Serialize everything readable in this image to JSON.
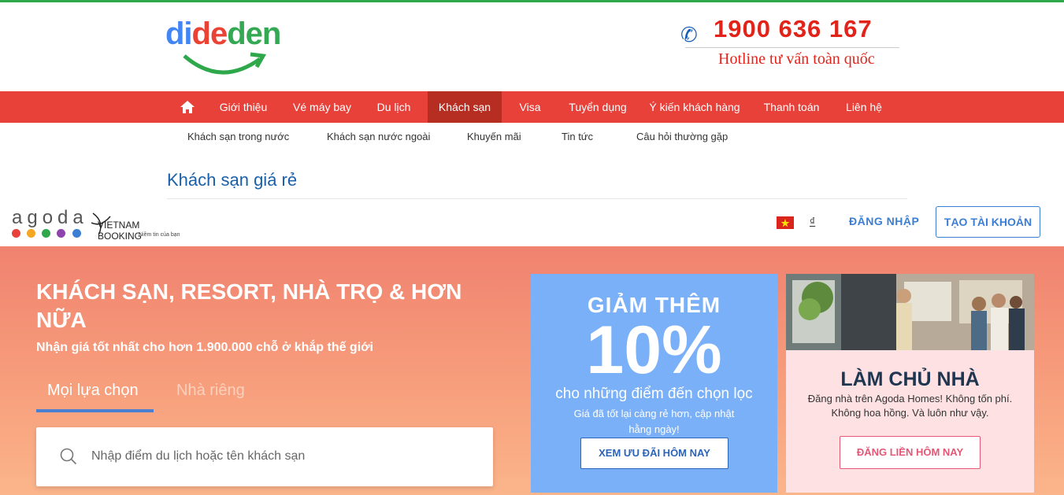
{
  "header": {
    "logo_parts": [
      "di",
      "de",
      "den"
    ],
    "hotline_number": "1900 636 167",
    "hotline_label": "Hotline tư vấn toàn quốc"
  },
  "nav": {
    "items": [
      "Giới thiệu",
      "Vé máy bay",
      "Du lịch",
      "Khách sạn",
      "Visa",
      "Tuyển dụng",
      "Ý kiến khách hàng",
      "Thanh toán",
      "Liên hệ"
    ],
    "active": "Khách sạn"
  },
  "subnav": {
    "items": [
      "Khách sạn trong nước",
      "Khách sạn nước ngoài",
      "Khuyến mãi",
      "Tin tức",
      "Câu hỏi thường gặp"
    ]
  },
  "page_title": "Khách sạn giá rẻ",
  "agoda_bar": {
    "brand": "agoda",
    "partner_title": "VIETNAM BOOKING",
    "partner_tagline": "Niềm tin của bạn",
    "currency": "₫",
    "login": "ĐĂNG NHẬP",
    "signup": "TẠO TÀI KHOẢN",
    "brand_dot_colors": [
      "#e8413a",
      "#f5a623",
      "#2ea84a",
      "#8e44ad",
      "#3b7ed4"
    ]
  },
  "hero": {
    "title": "KHÁCH SẠN, RESORT, NHÀ TRỌ & HƠN NỮA",
    "subtitle": "Nhận giá tốt nhất cho hơn 1.900.000 chỗ ở khắp thế giới",
    "tabs": [
      "Mọi lựa chọn",
      "Nhà riêng"
    ],
    "search_placeholder": "Nhập điểm du lịch hoặc tên khách sạn"
  },
  "promo_discount": {
    "heading": "GIẢM THÊM",
    "big": "10%",
    "sub": "cho những điểm đến chọn lọc",
    "small": "Giá đã tốt lại càng rẻ hơn, cập nhật hằng ngày!",
    "button": "XEM ƯU ĐÃI HÔM NAY"
  },
  "promo_host": {
    "heading": "LÀM CHỦ NHÀ",
    "sub": "Đăng nhà trên Agoda Homes! Không tốn phí. Không hoa hồng. Và luôn như vậy.",
    "button": "ĐĂNG LIỀN HÔM NAY"
  }
}
